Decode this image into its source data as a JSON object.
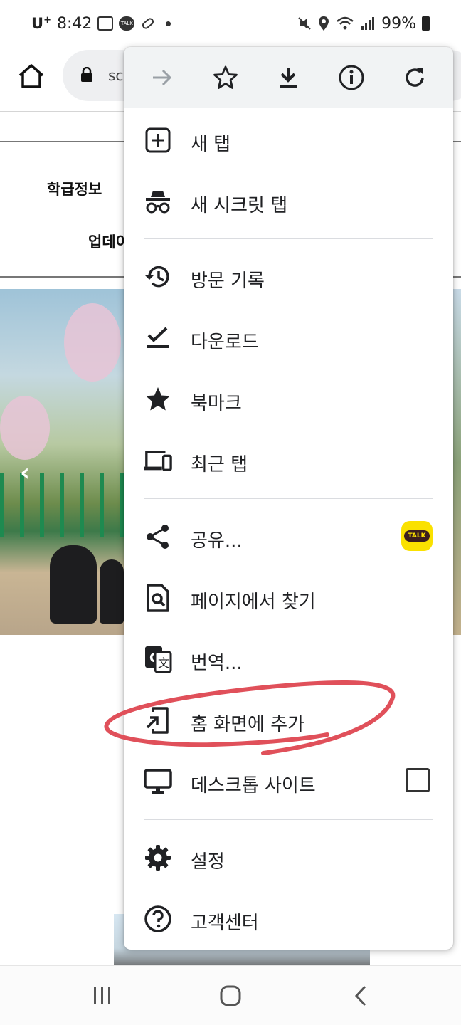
{
  "status_bar": {
    "carrier": "U",
    "carrier_sup": "+",
    "time": "8:42",
    "talk_label": "TALK",
    "battery": "99%"
  },
  "toolbar": {
    "url_fragment": "sc"
  },
  "page": {
    "nav_item_1": "학급정보",
    "nav_item_2": "업데이"
  },
  "menu": {
    "top_icons": [
      "forward-icon",
      "star-icon",
      "download-icon",
      "info-icon",
      "refresh-icon"
    ],
    "items": {
      "new_tab": "새 탭",
      "incognito": "새 시크릿 탭",
      "history": "방문 기록",
      "downloads": "다운로드",
      "bookmarks": "북마크",
      "recent_tabs": "최근 탭",
      "share": "공유...",
      "find_in_page": "페이지에서 찾기",
      "translate": "번역...",
      "add_to_home": "홈 화면에 추가",
      "desktop_site": "데스크톱 사이트",
      "settings": "설정",
      "help": "고객센터"
    },
    "share_badge": "TALK",
    "desktop_site_checked": false
  },
  "colors": {
    "menu_header_bg": "#f1f3f4",
    "annotation": "#e0505a",
    "kakao_yellow": "#fae100"
  }
}
